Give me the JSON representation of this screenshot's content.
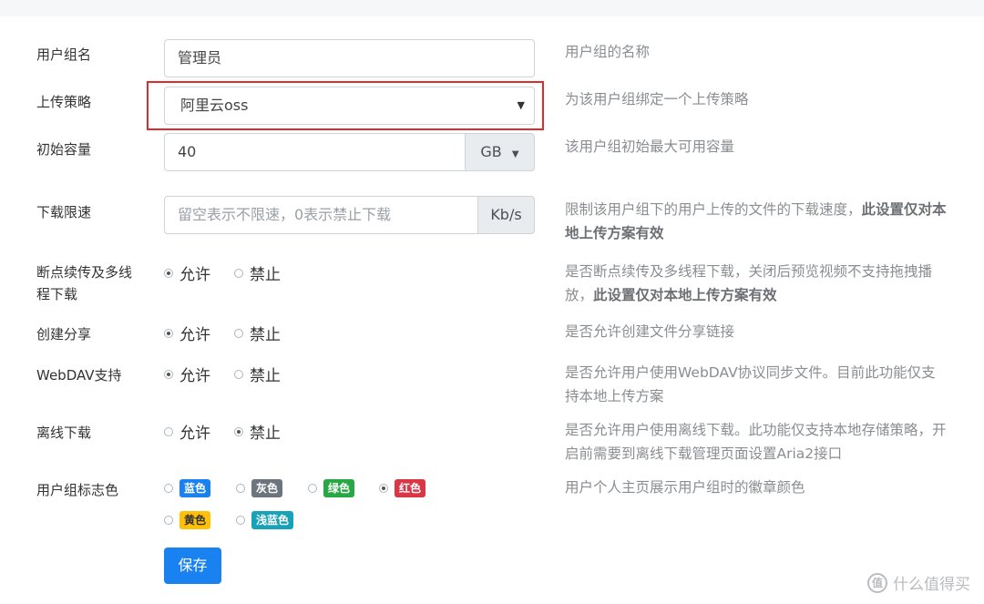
{
  "rows": {
    "group_name": {
      "label": "用户组名",
      "value": "管理员",
      "desc": "用户组的名称"
    },
    "upload_policy": {
      "label": "上传策略",
      "value": "阿里云oss",
      "desc": "为该用户组绑定一个上传策略"
    },
    "capacity": {
      "label": "初始容量",
      "value": "40",
      "unit": "GB",
      "desc": "该用户组初始最大可用容量"
    },
    "speed": {
      "label": "下载限速",
      "placeholder": "留空表示不限速，0表示禁止下载",
      "unit": "Kb/s",
      "desc": "限制该用户组下的用户上传的文件的下载速度，",
      "desc_bold": "此设置仅对本地上传方案有效"
    },
    "resume": {
      "label": "断点续传及多线程下载",
      "allow": "允许",
      "deny": "禁止",
      "desc": "是否断点续传及多线程下载，关闭后预览视频不支持拖拽播放，",
      "desc_bold": "此设置仅对本地上传方案有效"
    },
    "share": {
      "label": "创建分享",
      "allow": "允许",
      "deny": "禁止",
      "desc": "是否允许创建文件分享链接"
    },
    "webdav": {
      "label": "WebDAV支持",
      "allow": "允许",
      "deny": "禁止",
      "desc": "是否允许用户使用WebDAV协议同步文件。目前此功能仅支持本地上传方案"
    },
    "offline": {
      "label": "离线下载",
      "allow": "允许",
      "deny": "禁止",
      "desc": "是否允许用户使用离线下载。此功能仅支持本地存储策略，开启前需要到离线下载管理页面设置Aria2接口"
    },
    "color": {
      "label": "用户组标志色",
      "desc": "用户个人主页展示用户组时的徽章颜色",
      "options": [
        {
          "text": "蓝色",
          "color": "#1a82f0"
        },
        {
          "text": "灰色",
          "color": "#6c757d"
        },
        {
          "text": "绿色",
          "color": "#28a745"
        },
        {
          "text": "红色",
          "color": "#dc3545"
        },
        {
          "text": "黄色",
          "color": "#ffc107"
        },
        {
          "text": "浅蓝色",
          "color": "#17a2b8"
        }
      ],
      "selected": "红色"
    }
  },
  "save_label": "保存",
  "watermark": "什么值得买",
  "watermark_icon_text": "值"
}
